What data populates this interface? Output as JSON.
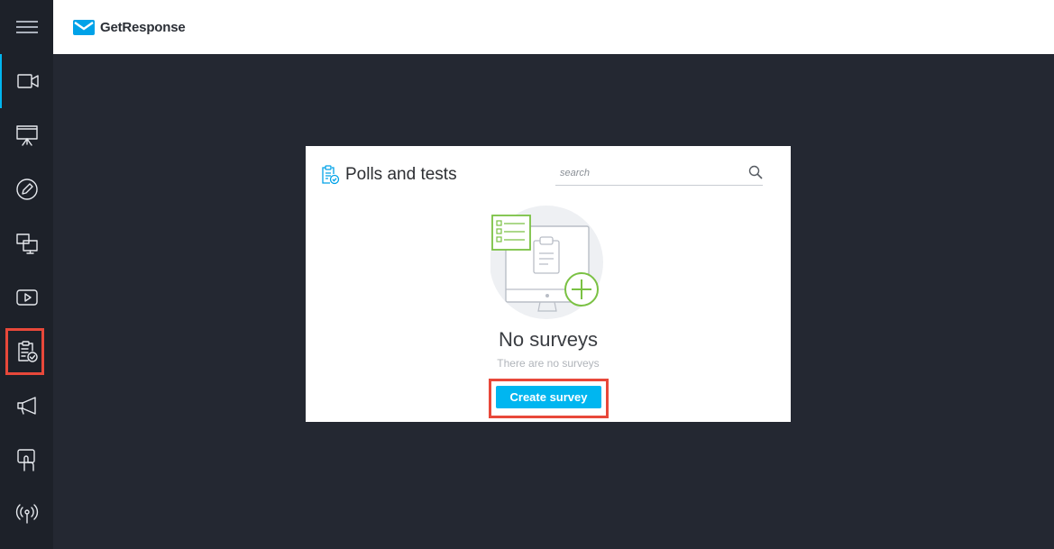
{
  "header": {
    "brand": "GetResponse",
    "logo_icon": "envelope-icon"
  },
  "sidebar": {
    "menu_icon": "hamburger-icon",
    "items": [
      {
        "icon": "video-camera-icon",
        "active": true
      },
      {
        "icon": "presentation-board-icon"
      },
      {
        "icon": "pencil-icon"
      },
      {
        "icon": "screen-share-icon"
      },
      {
        "icon": "video-play-icon"
      },
      {
        "icon": "survey-clipboard-icon",
        "highlighted": true
      },
      {
        "icon": "megaphone-icon"
      },
      {
        "icon": "touch-click-icon"
      },
      {
        "icon": "broadcast-icon"
      }
    ]
  },
  "panel": {
    "title": "Polls and tests",
    "search_placeholder": "search",
    "empty_title": "No surveys",
    "empty_subtitle": "There are no surveys",
    "create_button": "Create survey"
  },
  "colors": {
    "accent": "#00b6f0",
    "highlight": "#e8483a",
    "sidebar_bg": "#1d2129",
    "main_bg": "#242832",
    "illustration_green": "#7ac143"
  }
}
